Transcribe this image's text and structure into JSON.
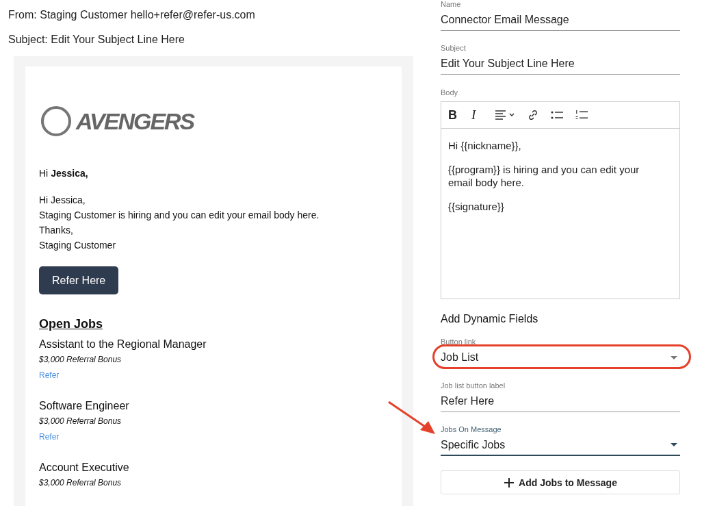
{
  "email_preview": {
    "from": "From: Staging Customer hello+refer@refer-us.com",
    "subject": "Subject: Edit Your Subject Line Here",
    "logo": {
      "text": "AVENGERS"
    },
    "greeting": "Hi **Jessica,**",
    "body_lines": [
      "Hi Jessica,",
      "Staging Customer is hiring and you can edit your email body here.",
      "Thanks,",
      "Staging Customer"
    ],
    "button": "Refer Here",
    "jobs_heading": "Open Jobs",
    "jobs": [
      {
        "title": "Assistant to the Regional Manager",
        "bonus": "$3,000 Referral Bonus",
        "link": "Refer"
      },
      {
        "title": "Software Engineer",
        "bonus": "$3,000 Referral Bonus",
        "link": "Refer"
      },
      {
        "title": "Account Executive",
        "bonus": "$3,000 Referral Bonus"
      }
    ]
  },
  "form": {
    "name": {
      "label": "Name",
      "value": "Connector Email Message"
    },
    "subject": {
      "label": "Subject",
      "value": "Edit Your Subject Line Here"
    },
    "body": {
      "label": "Body",
      "toolbar": [
        {
          "kind": "bold",
          "label": "B"
        },
        {
          "kind": "italic",
          "label": "I"
        },
        {
          "kind": "align"
        },
        {
          "kind": "link"
        },
        {
          "kind": "bullets"
        },
        {
          "kind": "numbered"
        }
      ],
      "paragraphs": [
        "Hi {{nickname}},",
        "{{program}} is hiring and you can edit your email body here.",
        "{{signature}}"
      ]
    },
    "dynamic_heading": "Add Dynamic Fields",
    "fields": [
      {
        "kind": "select",
        "label": "Button link",
        "value": "Job List",
        "focused": false,
        "highlighted": true
      },
      {
        "kind": "text",
        "label": "Job list button label",
        "value": "Refer Here",
        "focused": false,
        "highlighted": false
      },
      {
        "kind": "select",
        "label": "Jobs On Message",
        "value": "Specific Jobs",
        "focused": true,
        "highlighted": false,
        "arrow": true
      }
    ],
    "add_button": "Add Jobs to Message"
  }
}
